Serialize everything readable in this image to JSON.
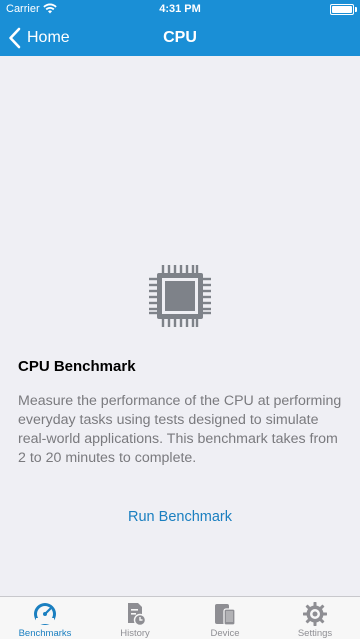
{
  "status_bar": {
    "carrier": "Carrier",
    "time": "4:31 PM"
  },
  "nav": {
    "back_label": "Home",
    "title": "CPU"
  },
  "benchmark": {
    "title": "CPU Benchmark",
    "description": "Measure the performance of the CPU at performing everyday tasks using tests designed to simulate real-world applications. This benchmark takes from 2 to 20 minutes to complete.",
    "run_label": "Run Benchmark",
    "icon": "cpu-chip-icon"
  },
  "tabs": [
    {
      "label": "Benchmarks",
      "icon": "gauge-icon",
      "active": true
    },
    {
      "label": "History",
      "icon": "history-icon",
      "active": false
    },
    {
      "label": "Device",
      "icon": "device-icon",
      "active": false
    },
    {
      "label": "Settings",
      "icon": "gear-icon",
      "active": false
    }
  ],
  "colors": {
    "accent": "#1a8fd6",
    "link": "#1a7fc0",
    "background": "#efeff4",
    "chip": "#7e8289"
  }
}
